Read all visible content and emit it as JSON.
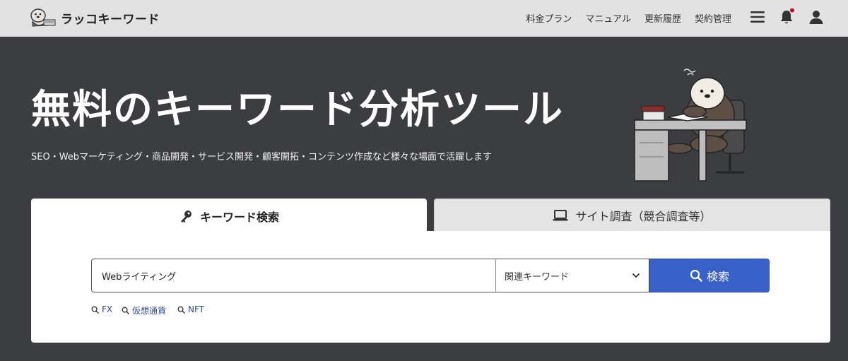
{
  "header": {
    "logo_text": "ラッコキーワード",
    "nav": [
      "料金プラン",
      "マニュアル",
      "更新履歴",
      "契約管理"
    ],
    "notification_dot_color": "#d0021b",
    "icons": [
      "menu-icon",
      "bell-icon",
      "user-icon"
    ]
  },
  "hero": {
    "title": "無料のキーワード分析ツール",
    "subtitle": "SEO・Webマーケティング・商品開発・サービス開発・顧客開拓・コンテンツ作成など様々な場面で活躍します"
  },
  "tabs": [
    {
      "label": "キーワード検索",
      "icon": "key-icon",
      "active": true
    },
    {
      "label": "サイト調査（競合調査等）",
      "icon": "laptop-icon",
      "active": false
    }
  ],
  "search": {
    "value": "Webライティング",
    "mode_selected": "関連キーワード",
    "button_label": "検索",
    "accent_color": "#3760c9"
  },
  "suggestions": [
    "FX",
    "仮想通貨",
    "NFT"
  ]
}
